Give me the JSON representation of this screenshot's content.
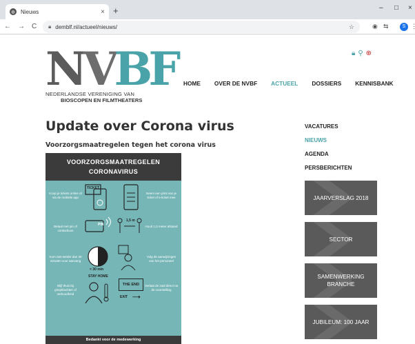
{
  "browser": {
    "tab_title": "Nieuws",
    "tab_close": "×",
    "new_tab": "+",
    "win_min": "–",
    "win_max": "□",
    "win_close": "×",
    "back": "←",
    "forward": "→",
    "reload": "C",
    "url": "demblf.nl/actueel/nieuws/",
    "avatar_letter": "S"
  },
  "logo": {
    "n": "N",
    "v": "V",
    "b": "B",
    "f": "F",
    "line1": "NEDERLANDSE VERENIGING VAN",
    "line2": "BIOSCOPEN EN FILMTHEATERS"
  },
  "nav": {
    "items": [
      "HOME",
      "OVER DE NVBF",
      "ACTUEEL",
      "DOSSIERS",
      "KENNISBANK"
    ],
    "active": "ACTUEEL"
  },
  "article": {
    "title": "Update over Corona virus",
    "subtitle": "Voorzorgsmaatregelen tegen het corona virus"
  },
  "poster": {
    "header_line1": "VOORZORGSMAATREGELEN",
    "header_line2": "CORONAVIRUS",
    "rows": [
      {
        "left": "Koop je tickets online of via de mobiele app",
        "right": "Neem een print van je ticket of e-ticket mee"
      },
      {
        "left": "Betaal met pin of contactloos",
        "right": "Houd 1,5 meter afstand"
      },
      {
        "left": "Kom niet eerder dan 30 minuten voor aanvang",
        "right": "Volg de aanwijzingen van het personeel"
      },
      {
        "left": "Blijf thuis bij griepklachten of verkoudheid",
        "right": "Verlaat de zaal direct na de voorstelling"
      }
    ],
    "ticket_label": "TICKET",
    "pin_label": "PIN",
    "distance_label": "1,5 m",
    "time_label": "< 30 min",
    "stay_home": "STAY HOME",
    "the_end": "THE END",
    "exit_label": "EXIT",
    "footer": "Bedankt voor de medewerking"
  },
  "sidebar": {
    "links": [
      "VACATURES",
      "NIEUWS",
      "AGENDA",
      "PERSBERICHTEN"
    ],
    "active": "NIEUWS",
    "tiles": [
      "JAARVERSLAG 2018",
      "SECTOR",
      "SAMENWERKING BRANCHE",
      "JUBILEUM: 100 JAAR"
    ]
  }
}
